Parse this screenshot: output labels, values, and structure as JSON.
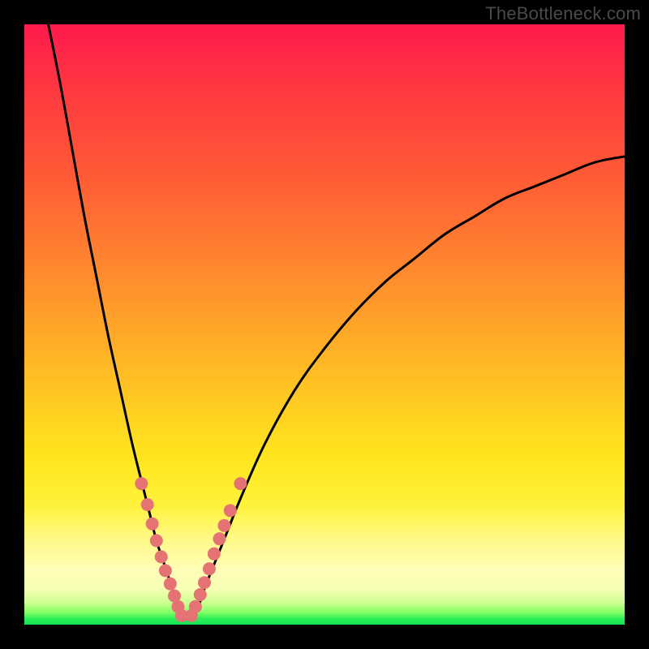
{
  "watermark": "TheBottleneck.com",
  "colors": {
    "curve": "#000000",
    "marker_fill": "#e57373",
    "marker_stroke": "#c94f4f",
    "gradient_top": "#ff1a4d",
    "gradient_bottom": "#17e35a",
    "frame": "#000000"
  },
  "chart_data": {
    "type": "line",
    "title": "",
    "xlabel": "",
    "ylabel": "",
    "xlim": [
      0,
      100
    ],
    "ylim": [
      0,
      100
    ],
    "grid": false,
    "legend": false,
    "note": "Axes are unlabeled in the image; values are positional percentages estimated from pixel geometry. y=0 is the bottom (green) edge, y=100 is the top (red) edge.",
    "series": [
      {
        "name": "left-branch",
        "type": "line",
        "x": [
          4,
          6,
          8,
          10,
          12,
          14,
          16,
          18,
          20,
          21,
          22,
          23,
          24,
          25,
          25.5,
          26
        ],
        "y": [
          100,
          90,
          79,
          68,
          58,
          48,
          39,
          30,
          22,
          18,
          14,
          11,
          8,
          5,
          3,
          1
        ]
      },
      {
        "name": "right-branch",
        "type": "line",
        "x": [
          28,
          29,
          30,
          32,
          34,
          36,
          40,
          45,
          50,
          55,
          60,
          65,
          70,
          75,
          80,
          85,
          90,
          95,
          100
        ],
        "y": [
          1,
          3,
          6,
          11,
          16,
          21,
          30,
          39,
          46,
          52,
          57,
          61,
          65,
          68,
          71,
          73,
          75,
          77,
          78
        ]
      },
      {
        "name": "left-branch-markers",
        "type": "scatter",
        "x": [
          19.5,
          20.5,
          21.3,
          22.0,
          22.8,
          23.5,
          24.3,
          25.0,
          25.6,
          26.2
        ],
        "y": [
          23.5,
          20.0,
          16.8,
          14.0,
          11.3,
          9.0,
          6.8,
          4.8,
          3.0,
          1.5
        ]
      },
      {
        "name": "right-branch-markers",
        "type": "scatter",
        "x": [
          27.8,
          28.5,
          29.3,
          30.0,
          30.8,
          31.6,
          32.5,
          33.3,
          34.3,
          36.0
        ],
        "y": [
          1.5,
          3.0,
          5.0,
          7.0,
          9.3,
          11.8,
          14.3,
          16.5,
          19.0,
          23.5
        ]
      }
    ]
  }
}
